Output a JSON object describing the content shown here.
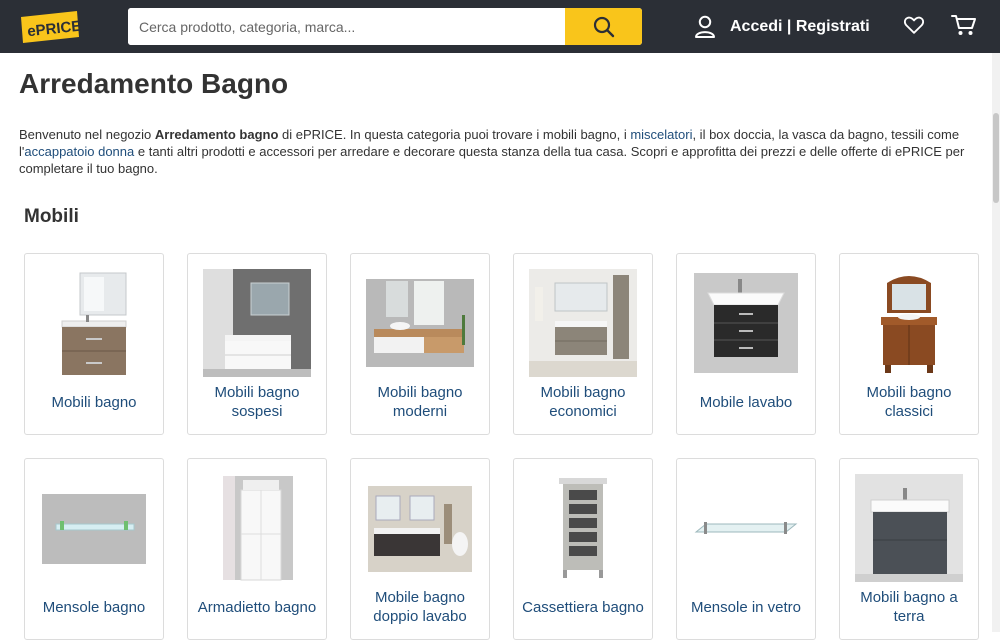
{
  "header": {
    "logo_text": "ePRICE",
    "search_placeholder": "Cerca prodotto, categoria, marca...",
    "login_label": "Accedi | Registrati",
    "colors": {
      "bar": "#2b2f36",
      "accent": "#f9c51b"
    }
  },
  "page": {
    "title": "Arredamento Bagno",
    "intro": {
      "t1": "Benvenuto nel negozio ",
      "b1": "Arredamento bagno",
      "t2": " di ePRICE. In questa categoria puoi trovare i mobili bagno, i ",
      "l1": "miscelatori",
      "t3": ", il box doccia, la vasca da bagno, tessili come l'",
      "l2": "accappatoio donna",
      "t4": " e tanti altri prodotti e accessori per arredare e decorare questa stanza della tua casa. Scopri e approfitta dei prezzi e delle offerte di ePRICE per completare il tuo bagno."
    },
    "section_title": "Mobili",
    "products": [
      {
        "label": "Mobili bagno"
      },
      {
        "label": "Mobili bagno sospesi"
      },
      {
        "label": "Mobili bagno moderni"
      },
      {
        "label": "Mobili bagno economici"
      },
      {
        "label": "Mobile lavabo"
      },
      {
        "label": "Mobili bagno classici"
      },
      {
        "label": "Mensole bagno"
      },
      {
        "label": "Armadietto bagno"
      },
      {
        "label": "Mobile bagno doppio lavabo"
      },
      {
        "label": "Cassettiera bagno"
      },
      {
        "label": "Mensole in vetro"
      },
      {
        "label": "Mobili bagno a terra"
      }
    ]
  }
}
